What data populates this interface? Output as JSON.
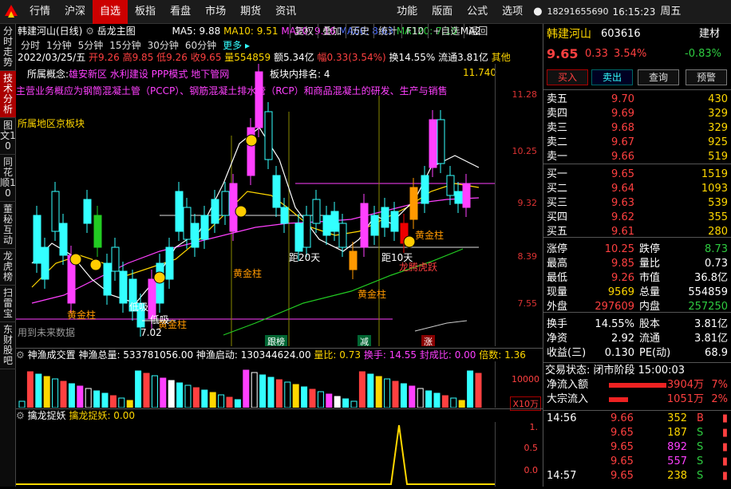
{
  "menu": {
    "items": [
      "行情",
      "沪深",
      "自选",
      "板指",
      "看盘",
      "市场",
      "期货",
      "资讯"
    ],
    "right_items": [
      "功能",
      "版面",
      "公式",
      "选项"
    ],
    "phone": "18291655690",
    "time": "16:15:23",
    "weekday": "周五"
  },
  "left_tabs": [
    "分时走势",
    "技术分析",
    "图文10",
    "同花顺10",
    "董秘互动",
    "龙虎榜",
    "扫雷宝",
    "东财股吧"
  ],
  "toolbar": {
    "stock": "韩建河山(日线)",
    "indicator": "岳龙主图",
    "ma5": "MA5: 9.88",
    "ma10": "MA10: 9.51",
    "ma20": "MA20: 9.16",
    "ma60": "MA60: 8.63",
    "ma120": "MA120: 7.10",
    "ma2": "MA2",
    "periods": [
      "分时",
      "1分钟",
      "5分钟",
      "15分钟",
      "30分钟",
      "60分钟",
      "更多 ▸"
    ],
    "right_tabs": [
      "复权",
      "叠加",
      "历史",
      "统计",
      "F10",
      "+自选",
      "返回"
    ]
  },
  "ohlc": {
    "date": "2022/03/25/五",
    "open": "开9.26",
    "high": "高9.85",
    "low": "低9.26",
    "close": "收9.65",
    "vol": "量554859",
    "amount": "额5.34亿",
    "range": "幅0.33(3.54%)",
    "turnover": "换14.55%",
    "float": "流通3.81亿",
    "other": "其他"
  },
  "chart": {
    "concepts_prefix": "所属概念:",
    "concepts": "雄安新区 水利建设 PPP模式 地下管网",
    "rank": "板块内排名: 4",
    "rank_val": "11.740",
    "business": "主营业务概应为钢筒混凝土管（PCCP）、钢筋混凝土排水管（RCP）和商品混凝土的研发、生产与销售",
    "region": "所属地区京板块",
    "ticks": [
      "11.28",
      "10.25",
      "9.32",
      "8.39",
      "7.55"
    ],
    "labels": {
      "gold1": "黄金柱",
      "gold2": "黄金柱",
      "gold3": "黄金柱",
      "gold4": "黄金柱",
      "gold5": "黄金柱",
      "gold6": "黄金柱",
      "ju20": "距20天",
      "ju10": "距10天",
      "dragon": "龙腾虎跃",
      "low": "7.02",
      "wg": "低吸",
      "wg2": "低吸",
      "future": "用到未来数据",
      "bot1": "跟榜",
      "bot2": "减",
      "bot3": "涨"
    }
  },
  "sub1": {
    "name": "神渔成交置",
    "total": "神渔总量: 533781056.00",
    "start": "神渔启动: 130344624.00",
    "ratio": "量比: 0.73",
    "turn": "换手: 14.55",
    "seal": "封成比: 0.00",
    "mult": "倍数: 1.36",
    "tick1": "10000",
    "unit": "X10万"
  },
  "sub2": {
    "name": "擒龙捉妖",
    "val": "擒龙捉妖: 0.00",
    "ticks": [
      "1.",
      "0.5",
      "0.0"
    ]
  },
  "quote": {
    "name": "韩建河山",
    "code": "603616",
    "sector": "建材",
    "price": "9.65",
    "chg": "0.33",
    "pct": "3.54%",
    "sector_pct": "-0.83%",
    "buttons": [
      "买入",
      "卖出",
      "查询",
      "预警"
    ],
    "asks": [
      {
        "l": "卖五",
        "p": "9.70",
        "v": "430"
      },
      {
        "l": "卖四",
        "p": "9.69",
        "v": "329"
      },
      {
        "l": "卖三",
        "p": "9.68",
        "v": "329"
      },
      {
        "l": "卖二",
        "p": "9.67",
        "v": "925"
      },
      {
        "l": "卖一",
        "p": "9.66",
        "v": "519"
      }
    ],
    "bids": [
      {
        "l": "买一",
        "p": "9.65",
        "v": "1519"
      },
      {
        "l": "买二",
        "p": "9.64",
        "v": "1093"
      },
      {
        "l": "买三",
        "p": "9.63",
        "v": "539"
      },
      {
        "l": "买四",
        "p": "9.62",
        "v": "355"
      },
      {
        "l": "买五",
        "p": "9.61",
        "v": "280"
      }
    ],
    "stats": [
      {
        "a": "涨停",
        "av": "10.25",
        "b": "跌停",
        "bv": "8.73",
        "ac": "red",
        "bc": "green"
      },
      {
        "a": "最高",
        "av": "9.85",
        "b": "量比",
        "bv": "0.73",
        "ac": "red",
        "bc": "wht"
      },
      {
        "a": "最低",
        "av": "9.26",
        "b": "市值",
        "bv": "36.8亿",
        "ac": "red",
        "bc": "wht"
      },
      {
        "a": "现量",
        "av": "9569",
        "b": "总量",
        "bv": "554859",
        "ac": "yel",
        "bc": "wht"
      },
      {
        "a": "外盘",
        "av": "297609",
        "b": "内盘",
        "bv": "257250",
        "ac": "red",
        "bc": "green"
      }
    ],
    "stats2": [
      {
        "a": "换手",
        "av": "14.55%",
        "b": "股本",
        "bv": "3.81亿"
      },
      {
        "a": "净资",
        "av": "2.92",
        "b": "流通",
        "bv": "3.81亿"
      },
      {
        "a": "收益(三)",
        "av": "0.130",
        "b": "PE(动)",
        "bv": "68.9"
      }
    ],
    "status": "交易状态: 闭市阶段 15:00:03",
    "flows": [
      {
        "l": "净流入额",
        "v": "3904万",
        "p": "7%",
        "c": "red",
        "fill": 0.36
      },
      {
        "l": "大宗流入",
        "v": "1051万",
        "p": "2%",
        "c": "red",
        "fill": 0.12
      }
    ],
    "ticks": [
      {
        "t": "14:56",
        "p": "9.66",
        "v": "352",
        "s": "B",
        "vc": "yel",
        "sc": "red"
      },
      {
        "t": "",
        "p": "9.65",
        "v": "187",
        "s": "S",
        "vc": "yel",
        "sc": "green"
      },
      {
        "t": "",
        "p": "9.65",
        "v": "892",
        "s": "S",
        "vc": "mag",
        "sc": "green"
      },
      {
        "t": "",
        "p": "9.65",
        "v": "557",
        "s": "S",
        "vc": "mag",
        "sc": "green"
      },
      {
        "t": "14:57",
        "p": "9.65",
        "v": "238",
        "s": "S",
        "vc": "yel",
        "sc": "green"
      }
    ]
  }
}
